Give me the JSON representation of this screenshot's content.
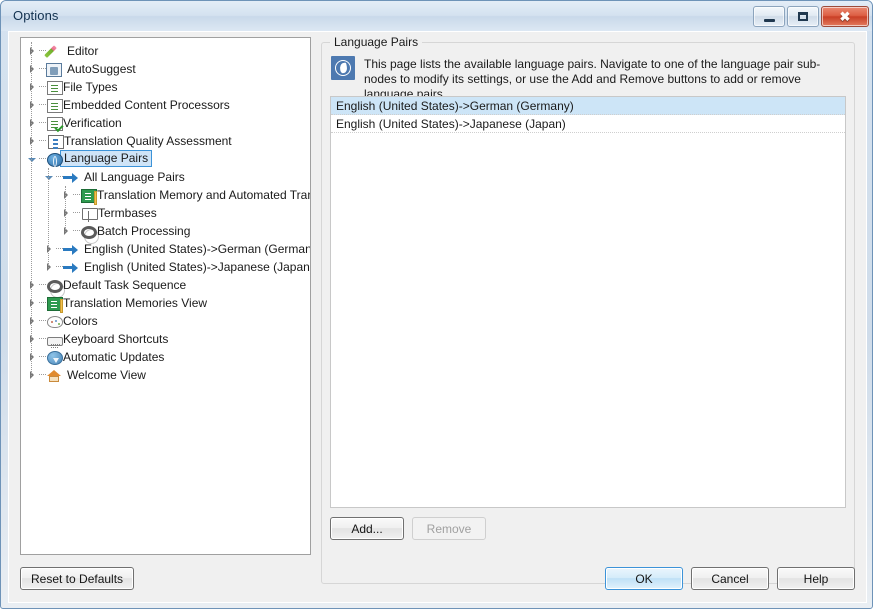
{
  "window": {
    "title": "Options",
    "controls": {
      "minimize": "minimize",
      "maximize": "maximize",
      "close": "✖"
    }
  },
  "tree": {
    "nodes": [
      {
        "label": "Editor",
        "icon": "pencil-icon",
        "level": 0,
        "state": "collapsed",
        "selected": false
      },
      {
        "label": "AutoSuggest",
        "icon": "autosuggest-icon",
        "level": 0,
        "state": "collapsed",
        "selected": false
      },
      {
        "label": "File Types",
        "icon": "file-types-icon",
        "level": 0,
        "state": "collapsed",
        "selected": false
      },
      {
        "label": "Embedded Content Processors",
        "icon": "embedded-content-icon",
        "level": 0,
        "state": "collapsed",
        "selected": false
      },
      {
        "label": "Verification",
        "icon": "verification-icon",
        "level": 0,
        "state": "collapsed",
        "selected": false
      },
      {
        "label": "Translation Quality Assessment",
        "icon": "quality-assessment-icon",
        "level": 0,
        "state": "collapsed",
        "selected": false
      },
      {
        "label": "Language Pairs",
        "icon": "globe-icon",
        "level": 0,
        "state": "expanded",
        "selected": true
      },
      {
        "label": "All Language Pairs",
        "icon": "arrow-right-icon",
        "level": 1,
        "state": "expanded",
        "selected": false
      },
      {
        "label": "Translation Memory and Automated Tran",
        "icon": "translation-memory-icon",
        "level": 2,
        "state": "collapsed",
        "selected": false
      },
      {
        "label": "Termbases",
        "icon": "termbase-icon",
        "level": 2,
        "state": "collapsed",
        "selected": false
      },
      {
        "label": "Batch Processing",
        "icon": "gear-icon",
        "level": 2,
        "state": "collapsed",
        "selected": false
      },
      {
        "label": "English (United States)->German (Germany)",
        "icon": "arrow-right-icon",
        "level": 1,
        "state": "collapsed",
        "selected": false
      },
      {
        "label": "English (United States)->Japanese (Japan)",
        "icon": "arrow-right-icon",
        "level": 1,
        "state": "collapsed",
        "selected": false
      },
      {
        "label": "Default Task Sequence",
        "icon": "gear-icon",
        "level": 0,
        "state": "collapsed",
        "selected": false
      },
      {
        "label": "Translation Memories View",
        "icon": "translation-memory-icon",
        "level": 0,
        "state": "collapsed",
        "selected": false
      },
      {
        "label": "Colors",
        "icon": "palette-icon",
        "level": 0,
        "state": "collapsed",
        "selected": false
      },
      {
        "label": "Keyboard Shortcuts",
        "icon": "keyboard-icon",
        "level": 0,
        "state": "collapsed",
        "selected": false
      },
      {
        "label": "Automatic Updates",
        "icon": "updates-icon",
        "level": 0,
        "state": "collapsed",
        "selected": false
      },
      {
        "label": "Welcome View",
        "icon": "home-icon",
        "level": 0,
        "state": "collapsed",
        "selected": false
      }
    ]
  },
  "panel": {
    "group_title": "Language Pairs",
    "description": "This page lists the available language pairs. Navigate to one of the language pair sub-nodes to modify its settings, or use the Add and Remove buttons to add or remove language pairs.",
    "description_icon": "globe-info-icon",
    "list": {
      "items": [
        {
          "label": "English (United States)->German (Germany)",
          "selected": true
        },
        {
          "label": "English (United States)->Japanese (Japan)",
          "selected": false
        }
      ]
    },
    "add_label": "Add...",
    "remove_label": "Remove",
    "remove_enabled": false
  },
  "footer": {
    "reset_label": "Reset to Defaults",
    "ok_label": "OK",
    "cancel_label": "Cancel",
    "help_label": "Help"
  },
  "colors": {
    "selection": "#cde5f7",
    "accent": "#3c93d8",
    "title_text": "#12314f",
    "close_button": "#c93f26"
  }
}
